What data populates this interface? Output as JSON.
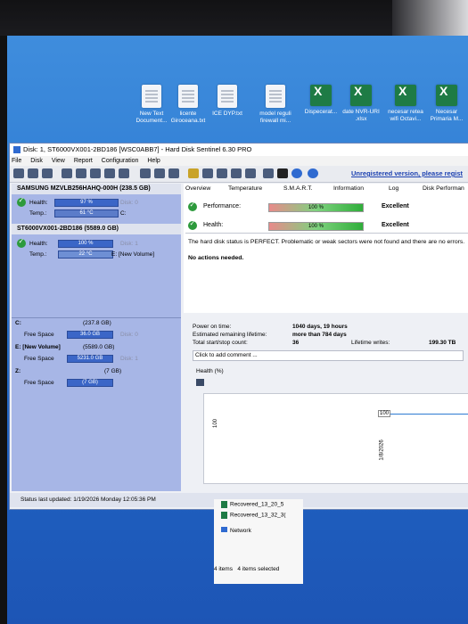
{
  "desktop": {
    "icons": [
      {
        "label": "New Text Document...",
        "type": "doc"
      },
      {
        "label": "licente Giroceana.txt",
        "type": "doc"
      },
      {
        "label": "ICE DYP.txt",
        "type": "doc"
      },
      {
        "label": "model reguli firewall mi...",
        "type": "doc"
      },
      {
        "label": "Dispecerat...",
        "type": "xlsx"
      },
      {
        "label": "date NVR-URI .xlsx",
        "type": "xlsx"
      },
      {
        "label": "necesar retea wifi Octavi...",
        "type": "xlsx"
      },
      {
        "label": "Necesar Primaria M...",
        "type": "xlsx"
      }
    ]
  },
  "window": {
    "title": "Disk: 1, ST6000VX001-2BD186 [WSC0ABB7]  -  Hard Disk Sentinel 6.30 PRO",
    "menu": [
      "File",
      "Disk",
      "View",
      "Report",
      "Configuration",
      "Help"
    ],
    "unregistered": "Unregistered version, please regist"
  },
  "disks": [
    {
      "name": "SAMSUNG MZVLB256HAHQ-000H (238.5 GB)",
      "health_label": "Health:",
      "health": "97 %",
      "disk_label": "Disk: 0",
      "temp_label": "Temp.:",
      "temp": "61 °C",
      "volume": "C:"
    },
    {
      "name": "ST6000VX001-2BD186 (5589.0 GB)",
      "health_label": "Health:",
      "health": "100 %",
      "disk_label": "Disk: 1",
      "temp_label": "Temp.:",
      "temp": "22 °C",
      "volume": "E: [New Volume]"
    }
  ],
  "volumes": [
    {
      "name": "C:",
      "size": "(237.8 GB)",
      "free_label": "Free Space",
      "free": "36.0 GB",
      "disk": "Disk: 0"
    },
    {
      "name": "E: [New Volume]",
      "size": "(5589.0 GB)",
      "free_label": "Free Space",
      "free": "5231.0 GB",
      "disk": "Disk: 1"
    },
    {
      "name": "Z:",
      "size": "(7 GB)",
      "free_label": "Free Space",
      "free": "(7 GB)",
      "disk": ""
    }
  ],
  "tabs": [
    "Overview",
    "Temperature",
    "S.M.A.R.T.",
    "Information",
    "Log",
    "Disk Performan"
  ],
  "overview": {
    "performance_label": "Performance:",
    "performance": "100 %",
    "performance_text": "Excellent",
    "health_label": "Health:",
    "health": "100 %",
    "health_text": "Excellent",
    "status_message": "The hard disk status is PERFECT. Problematic or weak sectors were not found and there are no errors.",
    "actions": "No actions needed.",
    "power_on_label": "Power on time:",
    "power_on": "1040 days, 19 hours",
    "remaining_label": "Estimated remaining lifetime:",
    "remaining": "more than 784 days",
    "start_stop_label": "Total start/stop count:",
    "start_stop": "36",
    "lifetime_writes_label": "Lifetime writes:",
    "lifetime_writes": "199.30 TB",
    "comment_placeholder": "Click to add comment ...",
    "health_chart_label": "Health (%)",
    "chart_y": "100",
    "chart_value": "100",
    "chart_date": "1/8/2026"
  },
  "status_bar": "Status last updated: 1/19/2026 Monday 12:05:36 PM",
  "explorer": {
    "files": [
      "Recovered_13_20_5",
      "Recovered_13_32_3("
    ],
    "network": "Network",
    "items": "4 items",
    "selected": "4 items selected"
  },
  "colors": {
    "desktop": "#2e7bd2",
    "left_pane": "#a7b6e6",
    "bar": "#3b66c7",
    "ok": "#2d9a3c"
  }
}
